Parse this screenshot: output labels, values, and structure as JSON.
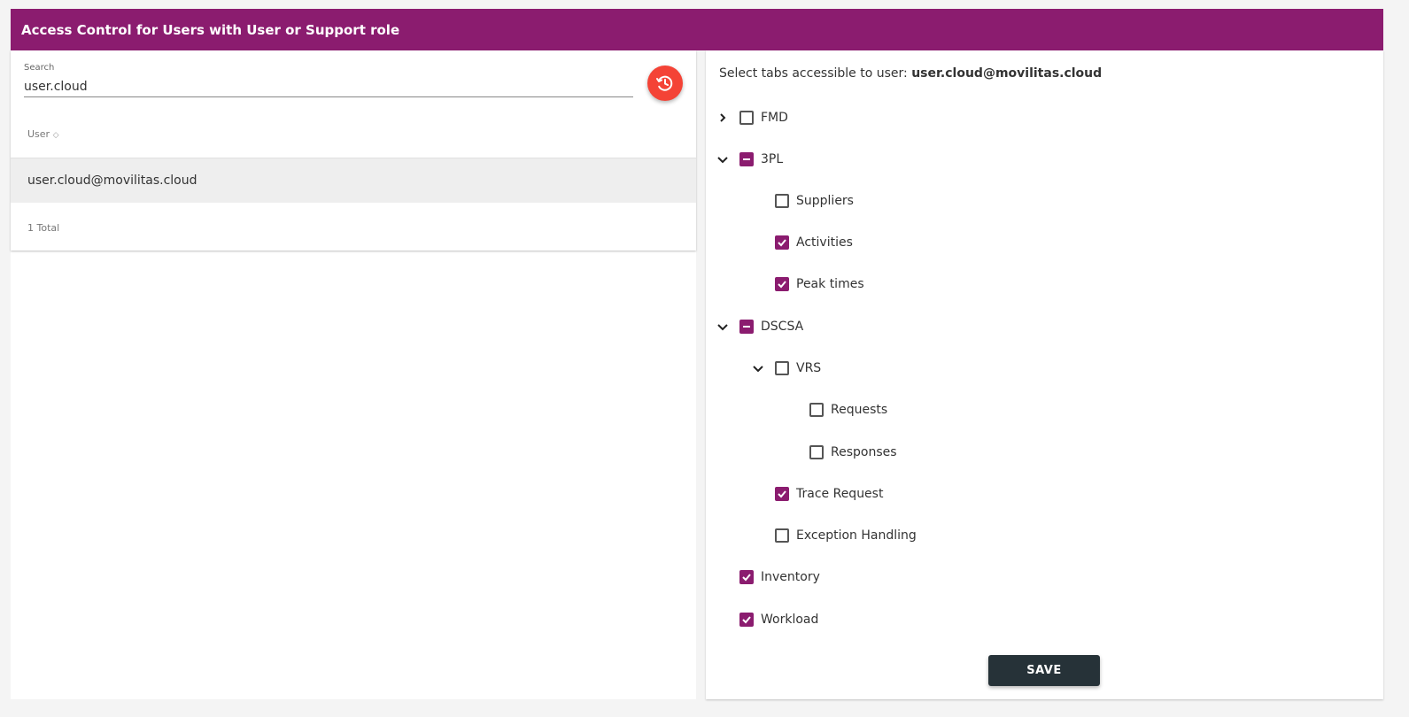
{
  "header": {
    "title": "Access Control for Users with User or Support role"
  },
  "search": {
    "label": "Search",
    "value": "user.cloud"
  },
  "fab": {
    "icon": "history-icon",
    "color": "#f44336"
  },
  "table": {
    "column": "User",
    "sort_indicator": "◇",
    "rows": [
      "user.cloud@movilitas.cloud"
    ],
    "total": "1 Total"
  },
  "tabs_panel": {
    "prefix": "Select tabs accessible to user:",
    "user": "user.cloud@movilitas.cloud"
  },
  "tree": [
    {
      "label": "FMD",
      "state": "unchecked",
      "expander": "chevron-right"
    },
    {
      "label": "3PL",
      "state": "partial",
      "expander": "chevron-down"
    },
    {
      "label": "Suppliers",
      "state": "unchecked"
    },
    {
      "label": "Activities",
      "state": "checked"
    },
    {
      "label": "Peak times",
      "state": "checked"
    },
    {
      "label": "DSCSA",
      "state": "partial",
      "expander": "chevron-down"
    },
    {
      "label": "VRS",
      "state": "unchecked",
      "expander": "chevron-down"
    },
    {
      "label": "Requests",
      "state": "unchecked"
    },
    {
      "label": "Responses",
      "state": "unchecked"
    },
    {
      "label": "Trace Request",
      "state": "checked"
    },
    {
      "label": "Exception Handling",
      "state": "unchecked"
    },
    {
      "label": "Inventory",
      "state": "checked"
    },
    {
      "label": "Workload",
      "state": "checked"
    }
  ],
  "save_label": "SAVE",
  "colors": {
    "brand": "#8b1c6f",
    "fab": "#f44336",
    "save_button": "#263238"
  }
}
